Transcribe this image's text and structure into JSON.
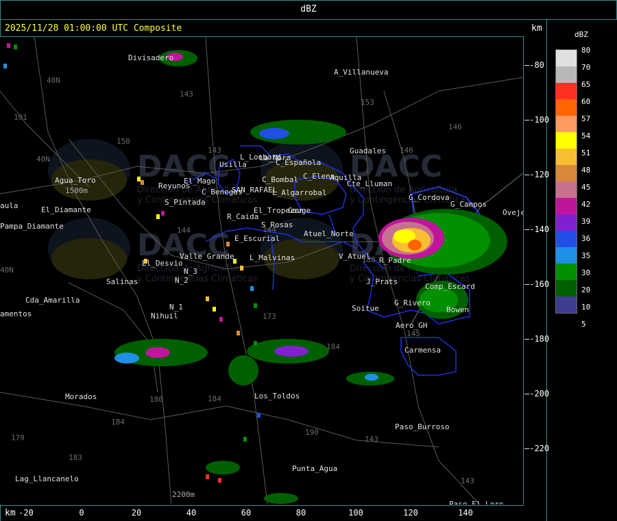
{
  "window_title": "dBZ",
  "timestamp": "2025/11/28 01:00:00 UTC Composite",
  "unit_top": "km",
  "unit_bottom": "km",
  "legend": {
    "title": "dBZ",
    "items": [
      {
        "label": "80",
        "color": "#e0e0e0"
      },
      {
        "label": "70",
        "color": "#b8b8b8"
      },
      {
        "label": "65",
        "color": "#ff3020"
      },
      {
        "label": "60",
        "color": "#ff6400"
      },
      {
        "label": "57",
        "color": "#ff9a60"
      },
      {
        "label": "54",
        "color": "#ffff00"
      },
      {
        "label": "51",
        "color": "#f8c030"
      },
      {
        "label": "48",
        "color": "#d88838"
      },
      {
        "label": "45",
        "color": "#c87090"
      },
      {
        "label": "42",
        "color": "#c0149c"
      },
      {
        "label": "39",
        "color": "#8020d0"
      },
      {
        "label": "36",
        "color": "#2050e8"
      },
      {
        "label": "35",
        "color": "#1e90e8"
      },
      {
        "label": "30",
        "color": "#009000"
      },
      {
        "label": "20",
        "color": "#006000"
      },
      {
        "label": "10",
        "color": "#3c3c90"
      },
      {
        "label": "5",
        "color": "#000000"
      }
    ]
  },
  "y_ticks": [
    "-80",
    "-100",
    "-120",
    "-140",
    "-160",
    "-180",
    "-200",
    "-220"
  ],
  "x_ticks": [
    "-20",
    "0",
    "20",
    "40",
    "60",
    "80",
    "100",
    "120",
    "140"
  ],
  "places": [
    {
      "id": "divisadero",
      "label": "Divisadero"
    },
    {
      "id": "a-villanueva",
      "label": "A_Villanueva"
    },
    {
      "id": "agua-toro",
      "label": "Agua_Toro"
    },
    {
      "id": "reyunos",
      "label": "Reyunos"
    },
    {
      "id": "el-mago",
      "label": "El_Mago"
    },
    {
      "id": "usilla",
      "label": "Usilla"
    },
    {
      "id": "l-lonbard",
      "label": "L_Lonbard"
    },
    {
      "id": "la-nora",
      "label": "La_Nora"
    },
    {
      "id": "c-espanola",
      "label": "C_Española"
    },
    {
      "id": "c-elena",
      "label": "C_Elena"
    },
    {
      "id": "aquilla",
      "label": "Aquilla"
    },
    {
      "id": "guadales",
      "label": "Guadales"
    },
    {
      "id": "c-benegas",
      "label": "C_Benegas"
    },
    {
      "id": "san-rafael",
      "label": "SAN_RAFAEL"
    },
    {
      "id": "c-bombal",
      "label": "C_Bombal"
    },
    {
      "id": "l-algarrobal",
      "label": "L_Algarrobal"
    },
    {
      "id": "cte-lluman",
      "label": "Cte_Lluman"
    },
    {
      "id": "g-cordova",
      "label": "G_Cordova"
    },
    {
      "id": "s-pintada",
      "label": "S_Pintada"
    },
    {
      "id": "el-tropezon",
      "label": "El_Tropezon"
    },
    {
      "id": "gouge",
      "label": "Gouge"
    },
    {
      "id": "g-campos",
      "label": "G_Campos"
    },
    {
      "id": "ovejero",
      "label": "Ovejero"
    },
    {
      "id": "r-caida",
      "label": "R_Caida"
    },
    {
      "id": "s-rosas",
      "label": "S_Rosas"
    },
    {
      "id": "pampa-diamante",
      "label": "Pampa_Diamante"
    },
    {
      "id": "el-diamante",
      "label": "El_Diamante"
    },
    {
      "id": "aula",
      "label": "aula"
    },
    {
      "id": "atuel-norte",
      "label": "Atuel_Norte"
    },
    {
      "id": "e-escurial",
      "label": "E_Escurial"
    },
    {
      "id": "valle-grande",
      "label": "Valle_Grande"
    },
    {
      "id": "l-malvinas",
      "label": "L_Malvinas"
    },
    {
      "id": "v-atuel",
      "label": "V_Atuel"
    },
    {
      "id": "r-padre",
      "label": "R_Padre"
    },
    {
      "id": "el-desvio",
      "label": "El_Desvio"
    },
    {
      "id": "n-2",
      "label": "N_2"
    },
    {
      "id": "n-3",
      "label": "N_3"
    },
    {
      "id": "salinas",
      "label": "Salinas"
    },
    {
      "id": "j-prats",
      "label": "J_Prats"
    },
    {
      "id": "comp-escard",
      "label": "Comp_Escard"
    },
    {
      "id": "cda-amarilla",
      "label": "Cda_Amarilla"
    },
    {
      "id": "n-1",
      "label": "N_1"
    },
    {
      "id": "nihuil",
      "label": "Nihuil"
    },
    {
      "id": "soitue",
      "label": "Soitue"
    },
    {
      "id": "g-rivero",
      "label": "G_Rivero"
    },
    {
      "id": "bowen",
      "label": "Bowen"
    },
    {
      "id": "amentos",
      "label": "amentos"
    },
    {
      "id": "aero-gh",
      "label": "Aero_GH"
    },
    {
      "id": "carmensa",
      "label": "Carmensa"
    },
    {
      "id": "morados",
      "label": "Morados"
    },
    {
      "id": "los-toldos",
      "label": "Los_Toldos"
    },
    {
      "id": "paso-burroso",
      "label": "Paso_Burroso"
    },
    {
      "id": "punta-agua",
      "label": "Punta_Agua"
    },
    {
      "id": "lag-llancanelo",
      "label": "Lag_Llancanelo"
    },
    {
      "id": "paso-el-loro",
      "label": "Paso_El_Loro"
    },
    {
      "id": "elev-1500",
      "label": "1500m"
    },
    {
      "id": "elev-2200",
      "label": "2200m"
    }
  ],
  "road_numbers": [
    "143",
    "153",
    "146",
    "101",
    "40N",
    "150",
    "40N",
    "143",
    "144",
    "144",
    "173",
    "180",
    "184",
    "184",
    "183",
    "179",
    "190",
    "143",
    "145",
    "188",
    "184",
    "146",
    "143",
    "40N"
  ],
  "watermark": {
    "brand": "DACC",
    "line1": "Dirección de Agricultura",
    "line2": "y Contingencias Climáticas"
  }
}
